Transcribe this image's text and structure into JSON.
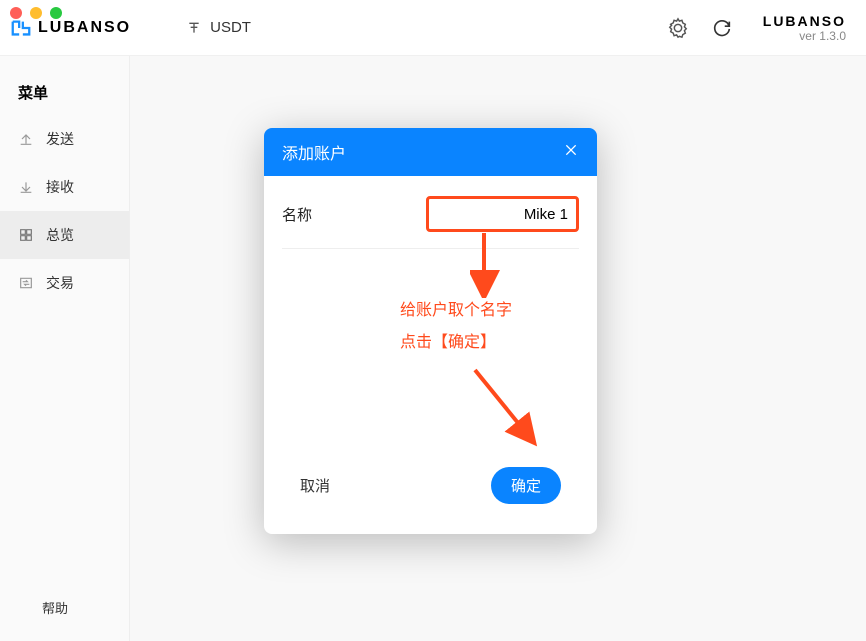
{
  "header": {
    "brand": "LUBANSO",
    "currency": "USDT",
    "brand_right": "LUBANSO",
    "version": "ver 1.3.0"
  },
  "sidebar": {
    "menu_title": "菜单",
    "items": [
      {
        "label": "发送"
      },
      {
        "label": "接收"
      },
      {
        "label": "总览"
      },
      {
        "label": "交易"
      }
    ],
    "help": "帮助"
  },
  "modal": {
    "title": "添加账户",
    "field_label": "名称",
    "field_value": "Mike 1",
    "cancel": "取消",
    "confirm": "确定"
  },
  "annotation": {
    "line1": "给账户取个名字",
    "line2": "点击【确定】"
  }
}
